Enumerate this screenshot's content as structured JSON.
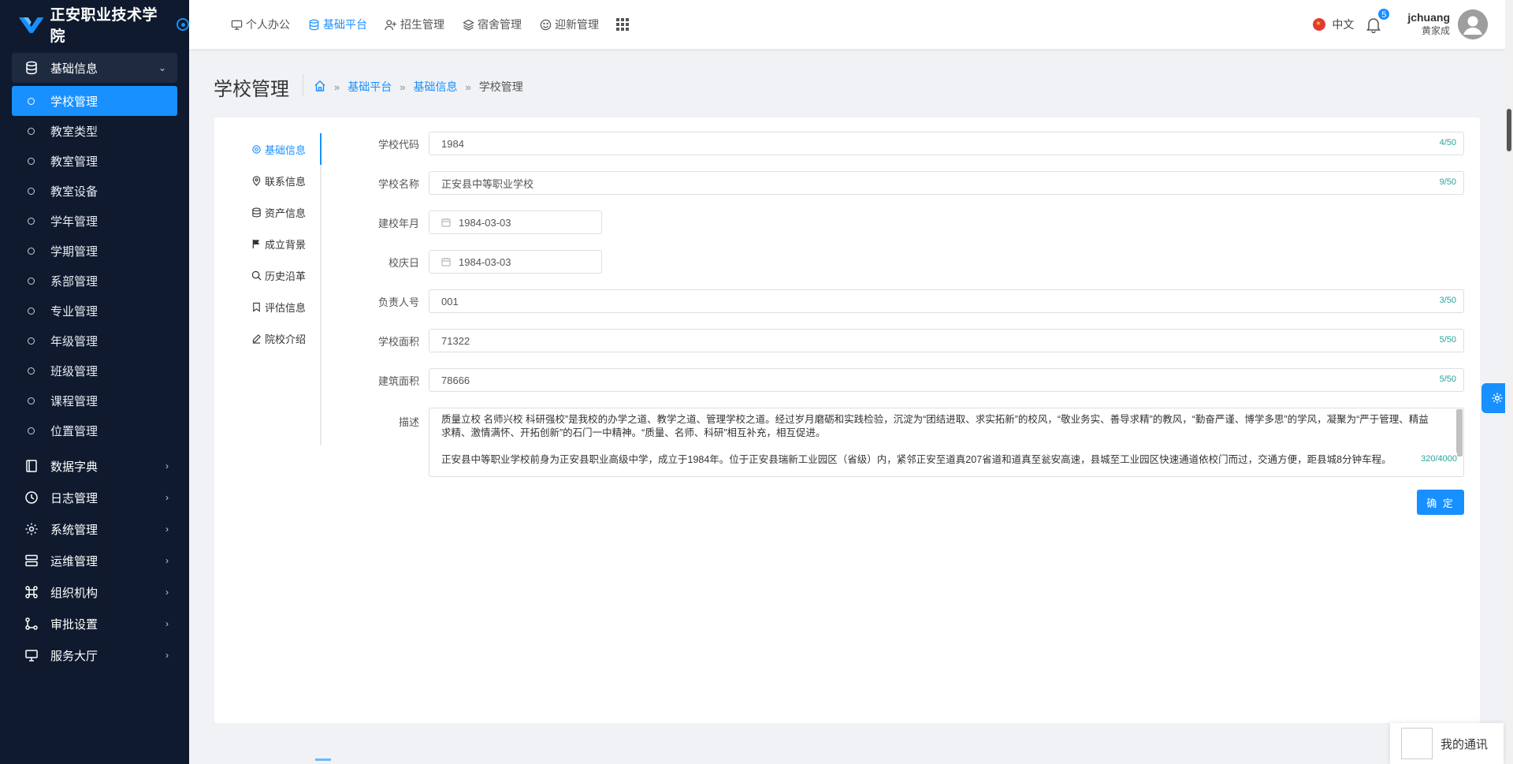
{
  "brand": {
    "title": "正安职业技术学院"
  },
  "sidebar": {
    "open_group": {
      "label": "基础信息",
      "icon": "database-icon"
    },
    "sub_items": [
      {
        "label": "学校管理",
        "active": true
      },
      {
        "label": "教室类型"
      },
      {
        "label": "教室管理"
      },
      {
        "label": "教室设备"
      },
      {
        "label": "学年管理"
      },
      {
        "label": "学期管理"
      },
      {
        "label": "系部管理"
      },
      {
        "label": "专业管理"
      },
      {
        "label": "年级管理"
      },
      {
        "label": "班级管理"
      },
      {
        "label": "课程管理"
      },
      {
        "label": "位置管理"
      }
    ],
    "groups": [
      {
        "label": "数据字典",
        "icon": "book-icon"
      },
      {
        "label": "日志管理",
        "icon": "clock-icon"
      },
      {
        "label": "系统管理",
        "icon": "gear-icon"
      },
      {
        "label": "运维管理",
        "icon": "server-icon"
      },
      {
        "label": "组织机构",
        "icon": "command-icon"
      },
      {
        "label": "审批设置",
        "icon": "flow-icon"
      },
      {
        "label": "服务大厅",
        "icon": "monitor-icon"
      }
    ]
  },
  "topnav": {
    "items": [
      {
        "label": "个人办公",
        "icon": "monitor-icon"
      },
      {
        "label": "基础平台",
        "icon": "database-icon",
        "active": true
      },
      {
        "label": "招生管理",
        "icon": "user-plus-icon"
      },
      {
        "label": "宿舍管理",
        "icon": "layers-icon"
      },
      {
        "label": "迎新管理",
        "icon": "smile-icon"
      }
    ],
    "apps_icon": "apps-grid-icon"
  },
  "header": {
    "language": "中文",
    "notification_count": "5",
    "user_name": "jchuang",
    "user_sub": "黄家成"
  },
  "page": {
    "title": "学校管理",
    "breadcrumb": [
      "基础平台",
      "基础信息",
      "学校管理"
    ]
  },
  "tabs": [
    {
      "label": "基础信息",
      "icon": "gear-icon",
      "active": true
    },
    {
      "label": "联系信息",
      "icon": "location-icon"
    },
    {
      "label": "资产信息",
      "icon": "database-icon"
    },
    {
      "label": "成立背景",
      "icon": "flag-icon"
    },
    {
      "label": "历史沿革",
      "icon": "search-icon"
    },
    {
      "label": "评估信息",
      "icon": "bookmark-icon"
    },
    {
      "label": "院校介绍",
      "icon": "edit-icon"
    }
  ],
  "form": {
    "school_code": {
      "label": "学校代码",
      "value": "1984",
      "count": "4/50"
    },
    "school_name": {
      "label": "学校名称",
      "value": "正安县中等职业学校",
      "count": "9/50"
    },
    "founded": {
      "label": "建校年月",
      "value": "1984-03-03"
    },
    "anniversary": {
      "label": "校庆日",
      "value": "1984-03-03"
    },
    "leader_no": {
      "label": "负责人号",
      "value": "001",
      "count": "3/50"
    },
    "school_area": {
      "label": "学校面积",
      "value": "71322",
      "count": "5/50"
    },
    "building_area": {
      "label": "建筑面积",
      "value": "78666",
      "count": "5/50"
    },
    "description": {
      "label": "描述",
      "para1": "质量立校 名师兴校 科研强校”是我校的办学之道、教学之道、管理学校之道。经过岁月磨砺和实践检验，沉淀为“团结进取、求实拓新”的校风，“敬业务实、善导求精”的教风，“勤奋严谨、博学多思”的学风，凝聚为“严于管理、精益求精、激情满怀、开拓创新”的石门一中精神。“质量、名师、科研”相互补充，相互促进。",
      "para2": "正安县中等职业学校前身为正安县职业高级中学，成立于1984年。位于正安县瑞新工业园区（省级）内，紧邻正安至道真207省道和道真至瓮安高速，县城至工业园区快速通道依校门而过，交通方便，距县城8分钟车程。",
      "count": "320/4000"
    },
    "submit_label": "确 定"
  },
  "floating": {
    "contacts_label": "我的通讯"
  }
}
